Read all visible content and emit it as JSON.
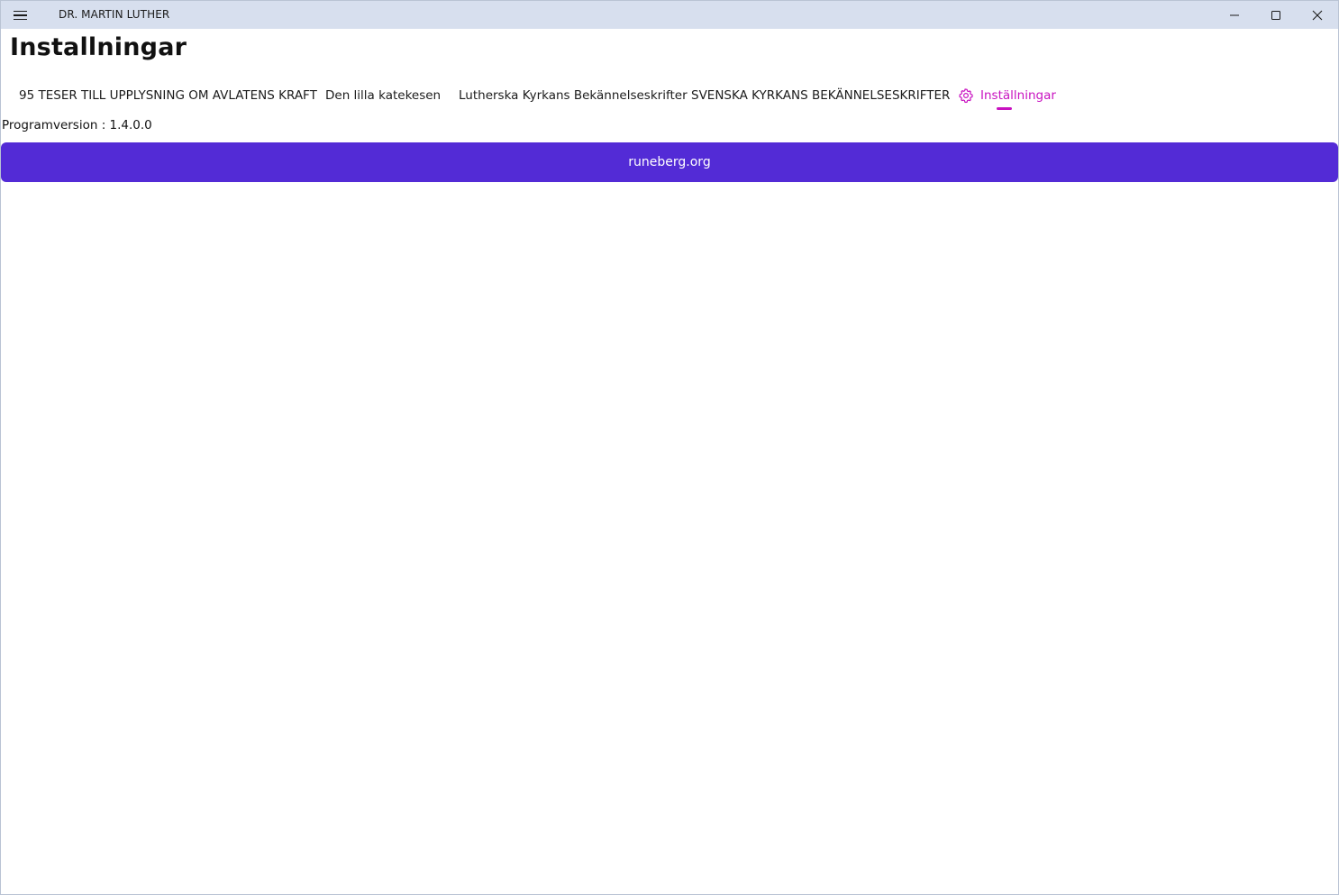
{
  "titlebar": {
    "app_title": "DR. MARTIN LUTHER",
    "menu_icon": "hamburger-menu-icon",
    "minimize_icon": "minimize-icon",
    "maximize_icon": "maximize-icon",
    "close_icon": "close-icon"
  },
  "page": {
    "title": "Installningar"
  },
  "tabs": [
    {
      "label": "95 TESER TILL UPPLYSNING OM AVLATENS KRAFT",
      "active": false
    },
    {
      "label": "Den lilla katekesen",
      "active": false
    },
    {
      "label": "Lutherska Kyrkans Bekännelseskrifter",
      "active": false
    },
    {
      "label": "SVENSKA KYRKANS BEKÄNNELSESKRIFTER",
      "active": false
    },
    {
      "label": "Inställningar",
      "active": true,
      "icon": "gear-icon"
    }
  ],
  "settings": {
    "version_label": "Programversion : 1.4.0.0",
    "link_button_label": "runeberg.org"
  },
  "colors": {
    "titlebar_bg": "#d7dfee",
    "active_tab": "#c812c0",
    "button_bg": "#532bd6",
    "button_text": "#ffffff"
  }
}
